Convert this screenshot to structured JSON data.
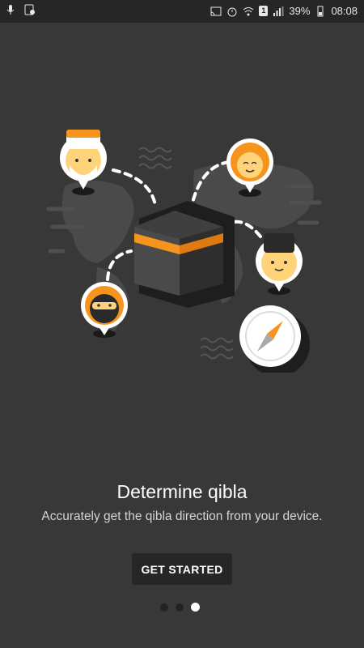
{
  "status_bar": {
    "battery_percent": "39%",
    "time": "08:08",
    "sim_badge": "1",
    "icons": [
      "mic-icon",
      "screen-record-icon",
      "cast-icon",
      "alarm-icon",
      "wifi-icon",
      "signal-icon",
      "battery-icon"
    ]
  },
  "onboarding": {
    "title": "Determine qibla",
    "subtitle": "Accurately get the qibla direction from your device.",
    "button_label": "GET STARTED",
    "page_count": 3,
    "active_page": 3
  },
  "colors": {
    "background": "#383838",
    "accent": "#f7941d",
    "button": "#262626"
  }
}
